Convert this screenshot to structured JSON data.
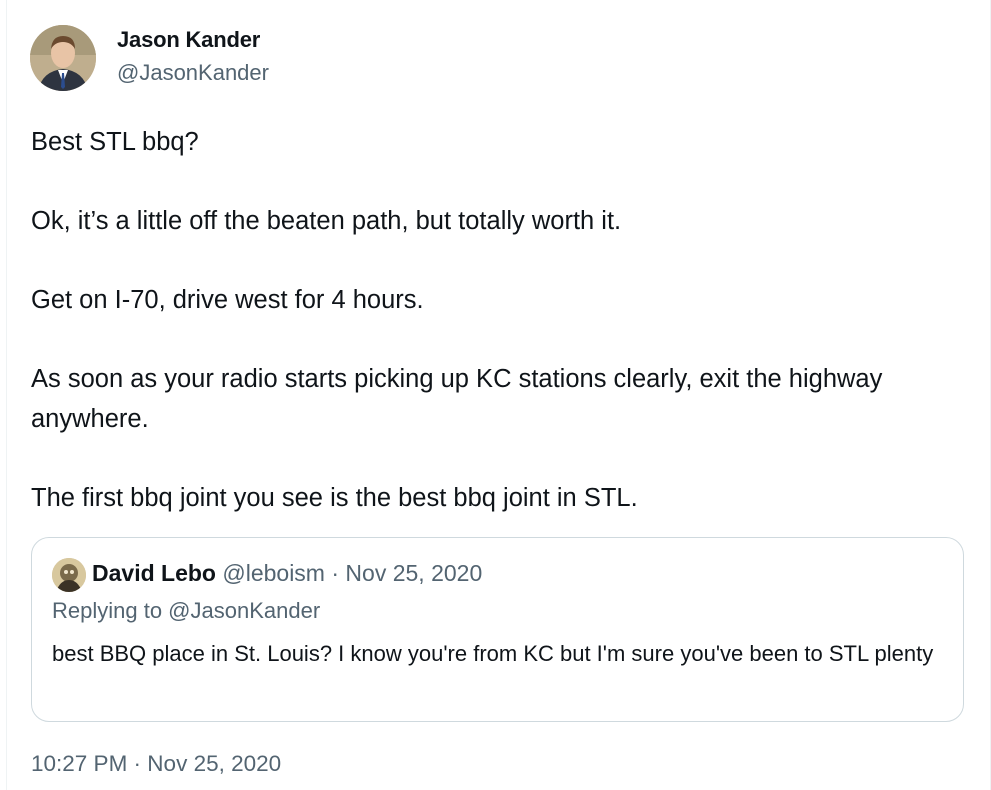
{
  "author": {
    "name": "Jason Kander",
    "handle": "@JasonKander"
  },
  "tweet": {
    "lines": [
      "Best STL bbq?",
      "Ok, it’s a little off the beaten path, but totally worth it.",
      "Get on I-70, drive west for 4 hours.",
      "As soon as your radio starts picking up KC stations clearly, exit the highway anywhere.",
      "The first bbq joint you see is the best bbq joint in STL."
    ],
    "timestamp": "10:27 PM · Nov 25, 2020"
  },
  "quoted": {
    "name": "David Lebo",
    "handle": "@leboism",
    "separator": "·",
    "date": "Nov 25, 2020",
    "replying_to": "Replying to @JasonKander",
    "text": "best BBQ place in St. Louis? I know you're from KC but I'm sure you've been to STL plenty"
  },
  "colors": {
    "text": "#0f1419",
    "secondary": "#536471",
    "border": "#cfd9de"
  }
}
